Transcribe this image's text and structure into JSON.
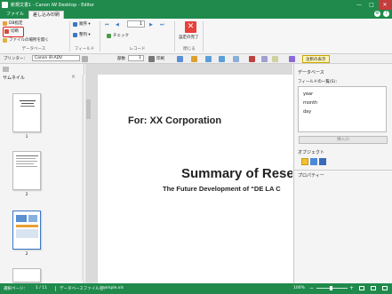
{
  "window": {
    "title": "新規文書1 - Canon iW Desktop - Editor"
  },
  "menu": {
    "tabs": [
      "ファイル",
      "差し込み印刷"
    ]
  },
  "ribbon": {
    "db_specify": "DB指定",
    "cut": "切断",
    "open_file_location": "ファイルの場所を開く",
    "group_database": "データベース",
    "order": "順序",
    "arrange": "整列",
    "group_field": "フィールド",
    "record_current": "1",
    "check": "チェック",
    "group_record": "レコード",
    "settings_done": "設定の完了",
    "group_close": "閉じる"
  },
  "toolbar2": {
    "printer_label": "プリンター：",
    "printer_value": "Canon iR-ADV",
    "copies_label": "部数",
    "copies_value": "1",
    "print_label": "印刷",
    "display_label": "注釈の表示"
  },
  "left_panel": {
    "title": "サムネイル",
    "thumbs": [
      "1",
      "2",
      "2"
    ]
  },
  "page": {
    "company": "For: XX Corporation",
    "title": "Summary of Rese",
    "subtitle": "The Future Development of “DE LA C"
  },
  "right_panel": {
    "db_title": "データベース",
    "field_list_label": "フィールドの一覧(S)：",
    "fields": [
      "year",
      "month",
      "day"
    ],
    "insert_button": "挿入(I)",
    "object_label": "オブジェクト",
    "property_label": "プロパティー"
  },
  "status": {
    "page_label": "選択ページ：",
    "page_value": "1 / 11",
    "db_file_label": "データベースファイル名：",
    "db_file_value": "sample.xls",
    "zoom": "100%"
  }
}
